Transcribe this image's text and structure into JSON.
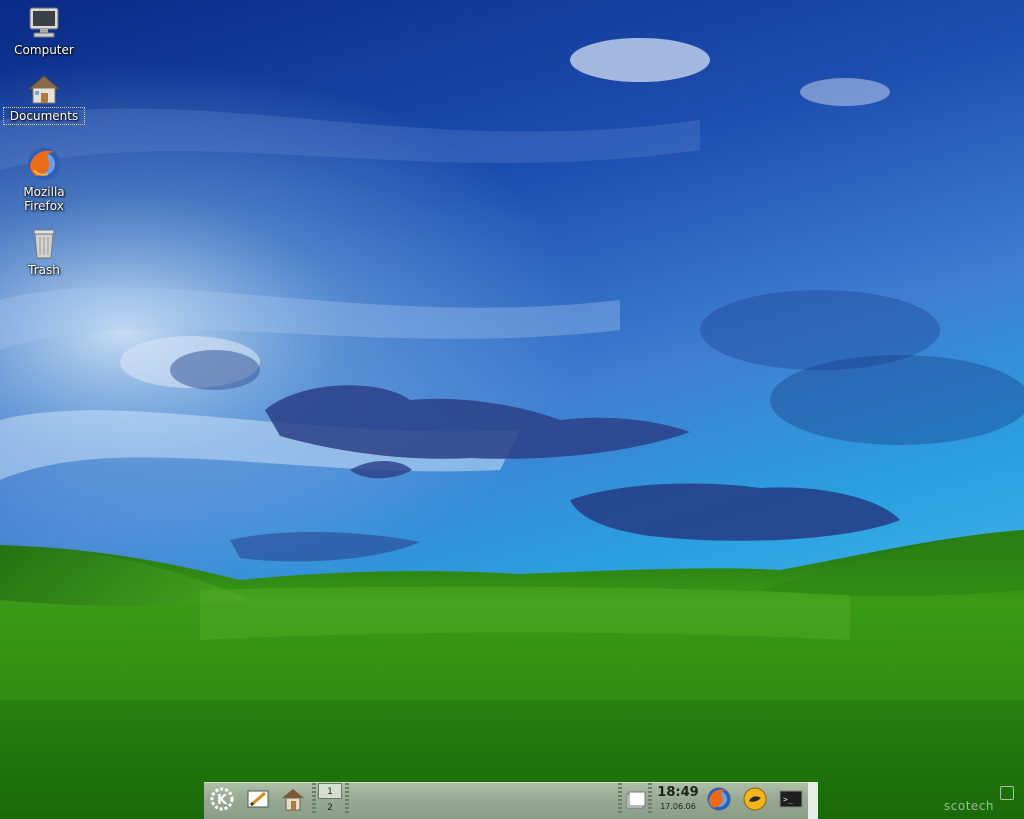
{
  "desktop": {
    "icons": [
      {
        "label": "Computer",
        "icon": "computer-icon"
      },
      {
        "label": "Documents",
        "icon": "home-folder-icon"
      },
      {
        "label": "Mozilla\nFirefox",
        "icon": "firefox-icon"
      },
      {
        "label": "Trash",
        "icon": "trash-icon"
      }
    ],
    "selected_icon": "Documents"
  },
  "panel": {
    "pager": [
      "1",
      "2"
    ],
    "active_desktop": "1",
    "clock_time": "18:49",
    "clock_date": "17.06.06",
    "launchers": [
      "kde-menu-icon",
      "text-editor-icon",
      "home-icon"
    ],
    "tray": [
      "files-icon",
      "firefox-icon",
      "gaim-icon",
      "terminal-icon"
    ]
  },
  "watermark": "scotech",
  "colors": {
    "sky_top": "#0b2f8e",
    "sky_bottom": "#3aa3e0",
    "grass": "#2e8a14",
    "panel": "#97a992"
  }
}
